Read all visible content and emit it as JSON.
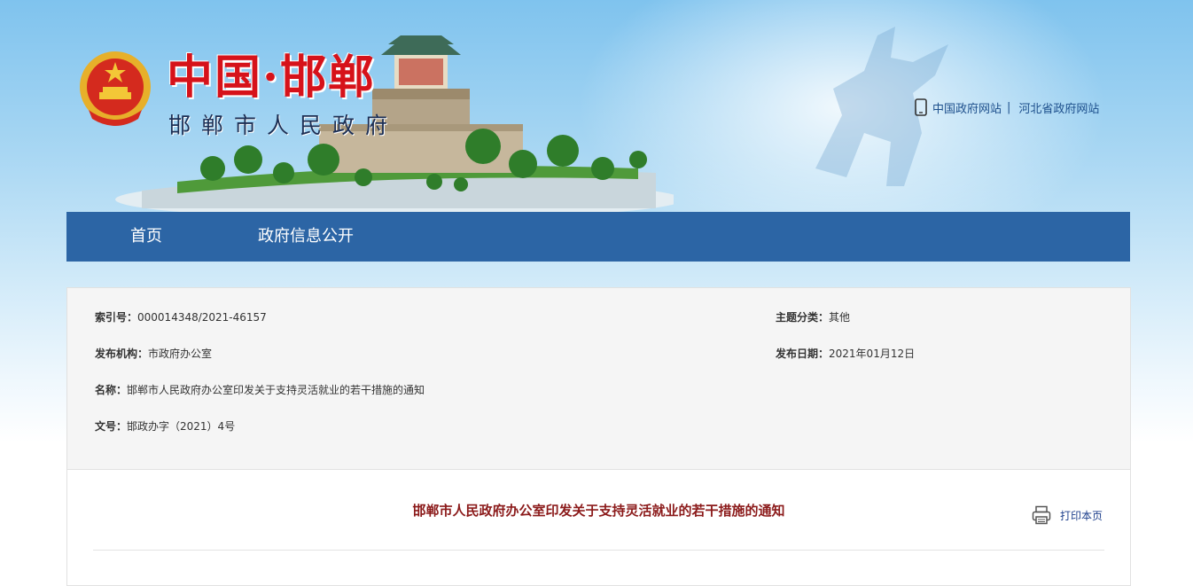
{
  "header": {
    "title": "中国·邯郸",
    "subtitle": "邯郸市人民政府",
    "links": [
      {
        "label": "中国政府网站"
      },
      {
        "label": "河北省政府网站"
      }
    ],
    "separator": "|"
  },
  "nav": {
    "items": [
      {
        "label": "首页"
      },
      {
        "label": "政府信息公开"
      }
    ]
  },
  "meta": {
    "index_no": {
      "label": "索引号：",
      "value": "000014348/2021-46157"
    },
    "category": {
      "label": "主题分类：",
      "value": "其他"
    },
    "publisher": {
      "label": "发布机构：",
      "value": "市政府办公室"
    },
    "publish_date": {
      "label": "发布日期：",
      "value": "2021年01月12日"
    },
    "name": {
      "label": "名称：",
      "value": "邯郸市人民政府办公室印发关于支持灵活就业的若干措施的通知"
    },
    "doc_no": {
      "label": "文号：",
      "value": "邯政办字（2021）4号"
    }
  },
  "article": {
    "title": "邯郸市人民政府办公室印发关于支持灵活就业的若干措施的通知",
    "print_label": "打印本页"
  },
  "colors": {
    "nav_bg": "#2c65a5",
    "title_red": "#d6121a",
    "article_title": "#8b1a1a",
    "link_blue": "#1d4f8c"
  },
  "icons": [
    "national-emblem-icon",
    "phone-icon",
    "print-icon"
  ]
}
